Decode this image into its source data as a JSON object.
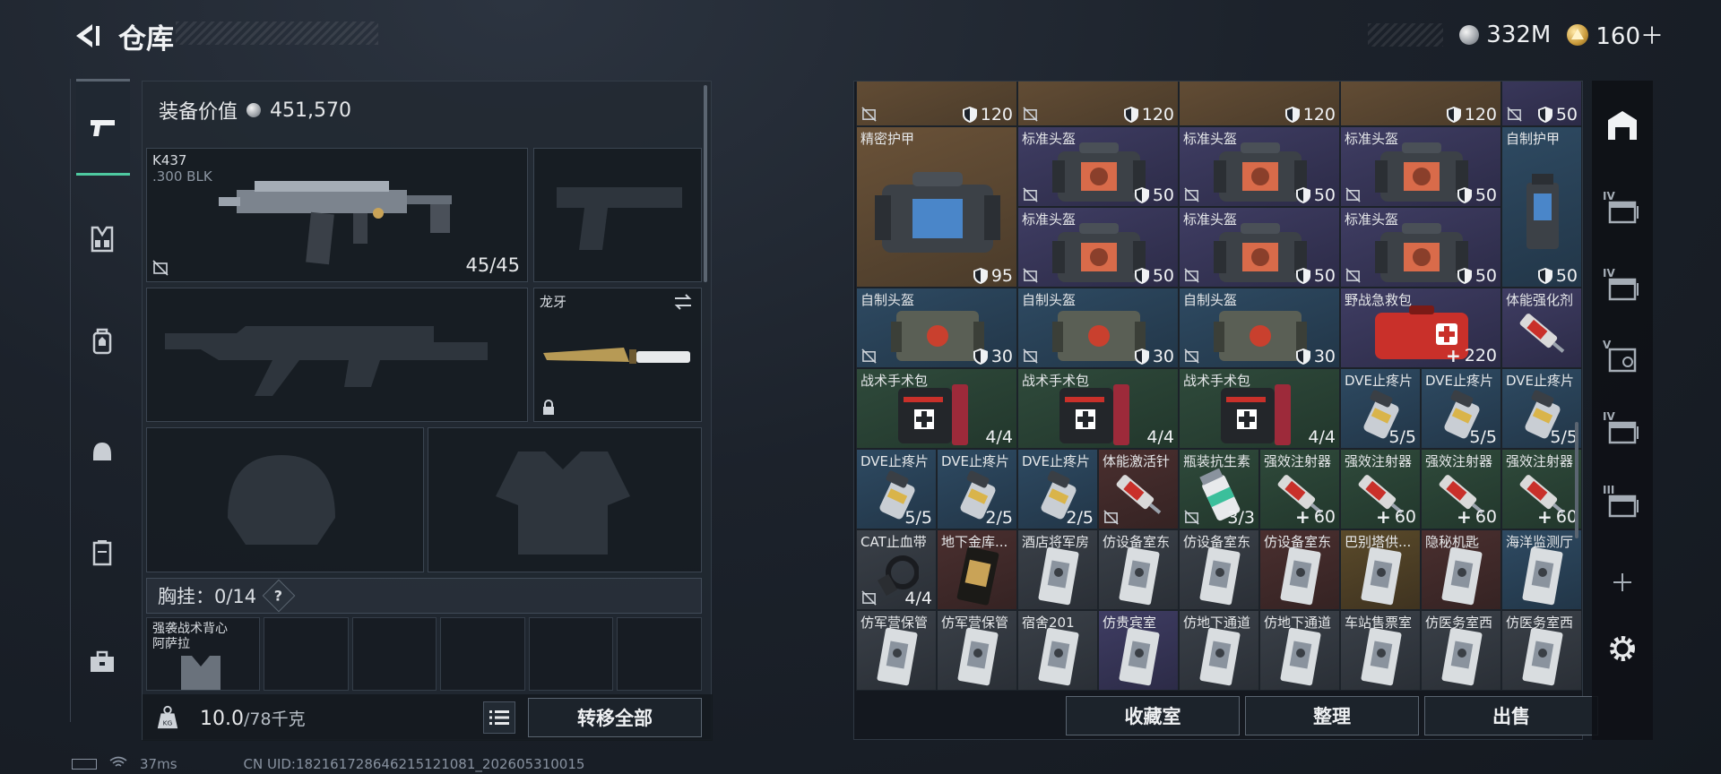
{
  "header": {
    "title": "仓库"
  },
  "currency": [
    {
      "icon": "silver-coin-icon",
      "value": "332M"
    },
    {
      "icon": "gold-triangle-coin-icon",
      "value": "160＋"
    }
  ],
  "left_rail": [
    {
      "icon": "pistol-icon",
      "active": true
    },
    {
      "icon": "chest-rig-icon"
    },
    {
      "icon": "backpack-icon"
    },
    {
      "icon": "helmet-bag-icon"
    },
    {
      "icon": "locker-icon"
    },
    {
      "icon": "toolbox-icon"
    }
  ],
  "equipment": {
    "value_label": "装备价值",
    "value": "451,570",
    "primary_weapon": {
      "name": "K437",
      "caliber": ".300 BLK",
      "ammo": "45/45"
    },
    "melee": {
      "name": "龙牙"
    },
    "chest_rig": {
      "label": "胸挂：",
      "count": "0/14",
      "help": "?"
    },
    "pouch": {
      "line1": "强袭战术背心",
      "line2": "阿萨拉"
    },
    "weight": {
      "current": "10.0",
      "max": "/78千克"
    },
    "transfer_all": "转移全部"
  },
  "inventory": {
    "rows": [
      [
        {
          "name": "",
          "val": "120",
          "type": "shield",
          "bg": "bg-brown",
          "noicon": true,
          "item": ""
        },
        {
          "name": "",
          "val": "120",
          "type": "shield",
          "bg": "bg-brown",
          "noicon": true,
          "item": ""
        },
        {
          "name": "",
          "val": "120",
          "type": "shield",
          "bg": "bg-brown",
          "noicon": false,
          "item": ""
        },
        {
          "name": "",
          "val": "120",
          "type": "shield",
          "bg": "bg-brown",
          "noicon": false,
          "item": ""
        },
        {
          "name": "",
          "val": "50",
          "type": "shield",
          "bg": "bg-purple",
          "noicon": true,
          "item": ""
        }
      ]
    ],
    "precision_armor": {
      "name": "精密护甲",
      "val": "95"
    },
    "helmets_row1": [
      {
        "name": "标准头盔",
        "val": "50"
      },
      {
        "name": "标准头盔",
        "val": "50"
      },
      {
        "name": "标准头盔",
        "val": "50"
      }
    ],
    "self_armor": {
      "name": "自制护甲",
      "val": "50"
    },
    "helmets_row2": [
      {
        "name": "标准头盔",
        "val": "50"
      },
      {
        "name": "标准头盔",
        "val": "50"
      },
      {
        "name": "标准头盔",
        "val": "50"
      }
    ],
    "row4": [
      {
        "name": "自制头盔",
        "val": "30"
      },
      {
        "name": "自制头盔",
        "val": "30"
      },
      {
        "name": "自制头盔",
        "val": "30"
      }
    ],
    "field_kit": {
      "name": "野战急救包",
      "val": "220"
    },
    "stim": {
      "name": "体能强化剂"
    },
    "row5_kits": [
      {
        "name": "战术手术包",
        "val": "4/4"
      },
      {
        "name": "战术手术包",
        "val": "4/4"
      },
      {
        "name": "战术手术包",
        "val": "4/4"
      }
    ],
    "row5_pills": [
      {
        "name": "DVE止疼片",
        "val": "5/5"
      },
      {
        "name": "DVE止疼片",
        "val": "5/5"
      },
      {
        "name": "DVE止疼片",
        "val": "5/5"
      }
    ],
    "row6": [
      {
        "name": "DVE止疼片",
        "val": "5/5",
        "kind": "pill"
      },
      {
        "name": "DVE止疼片",
        "val": "2/5",
        "kind": "pill"
      },
      {
        "name": "DVE止疼片",
        "val": "2/5",
        "kind": "pill"
      },
      {
        "name": "体能激活针",
        "val": "",
        "kind": "syringe"
      },
      {
        "name": "瓶装抗生素",
        "val": "3/3",
        "kind": "bottle"
      },
      {
        "name": "强效注射器",
        "val": "60",
        "kind": "syringe"
      },
      {
        "name": "强效注射器",
        "val": "60",
        "kind": "syringe"
      },
      {
        "name": "强效注射器",
        "val": "60",
        "kind": "syringe"
      },
      {
        "name": "强效注射器",
        "val": "60",
        "kind": "syringe"
      }
    ],
    "row7": [
      {
        "name": "CAT止血带",
        "val": "4/4",
        "kind": "tourniquet"
      },
      {
        "name": "地下金库...",
        "val": "",
        "kind": "goldcard"
      },
      {
        "name": "酒店将军房",
        "val": "",
        "kind": "card"
      },
      {
        "name": "仿设备室东",
        "val": "",
        "kind": "card"
      },
      {
        "name": "仿设备室东",
        "val": "",
        "kind": "card"
      },
      {
        "name": "仿设备室东",
        "val": "",
        "kind": "card"
      },
      {
        "name": "巴别塔供...",
        "val": "",
        "kind": "card"
      },
      {
        "name": "隐秘机匙",
        "val": "",
        "kind": "card"
      },
      {
        "name": "海洋监测厅",
        "val": "",
        "kind": "card"
      }
    ],
    "row8": [
      {
        "name": "仿军营保管",
        "kind": "card"
      },
      {
        "name": "仿军营保管",
        "kind": "card"
      },
      {
        "name": "宿舍201",
        "kind": "card"
      },
      {
        "name": "仿贵宾室",
        "kind": "card"
      },
      {
        "name": "仿地下通道",
        "kind": "card"
      },
      {
        "name": "仿地下通道",
        "kind": "card"
      },
      {
        "name": "车站售票室",
        "kind": "card"
      },
      {
        "name": "仿医务室西",
        "kind": "card"
      },
      {
        "name": "仿医务室西",
        "kind": "card"
      }
    ],
    "buttons": {
      "collection": "收藏室",
      "organize": "整理",
      "sell": "出售"
    }
  },
  "right_rail": [
    {
      "icon": "warehouse-icon",
      "roman": ""
    },
    {
      "icon": "storage-box-icon",
      "roman": "IV"
    },
    {
      "icon": "storage-box-icon",
      "roman": "IV"
    },
    {
      "icon": "storage-safe-icon",
      "roman": "V"
    },
    {
      "icon": "storage-box-icon",
      "roman": "IV"
    },
    {
      "icon": "storage-box-icon",
      "roman": "III"
    },
    {
      "icon": "plus-icon",
      "roman": ""
    },
    {
      "icon": "gear-icon",
      "roman": ""
    }
  ],
  "status": {
    "ping": "37ms",
    "uid": "CN UID:182161728646215121081_202605310015"
  },
  "colors": {
    "accent": "#4ec9a0",
    "panel": "#222932",
    "text": "#e6e8ea"
  }
}
